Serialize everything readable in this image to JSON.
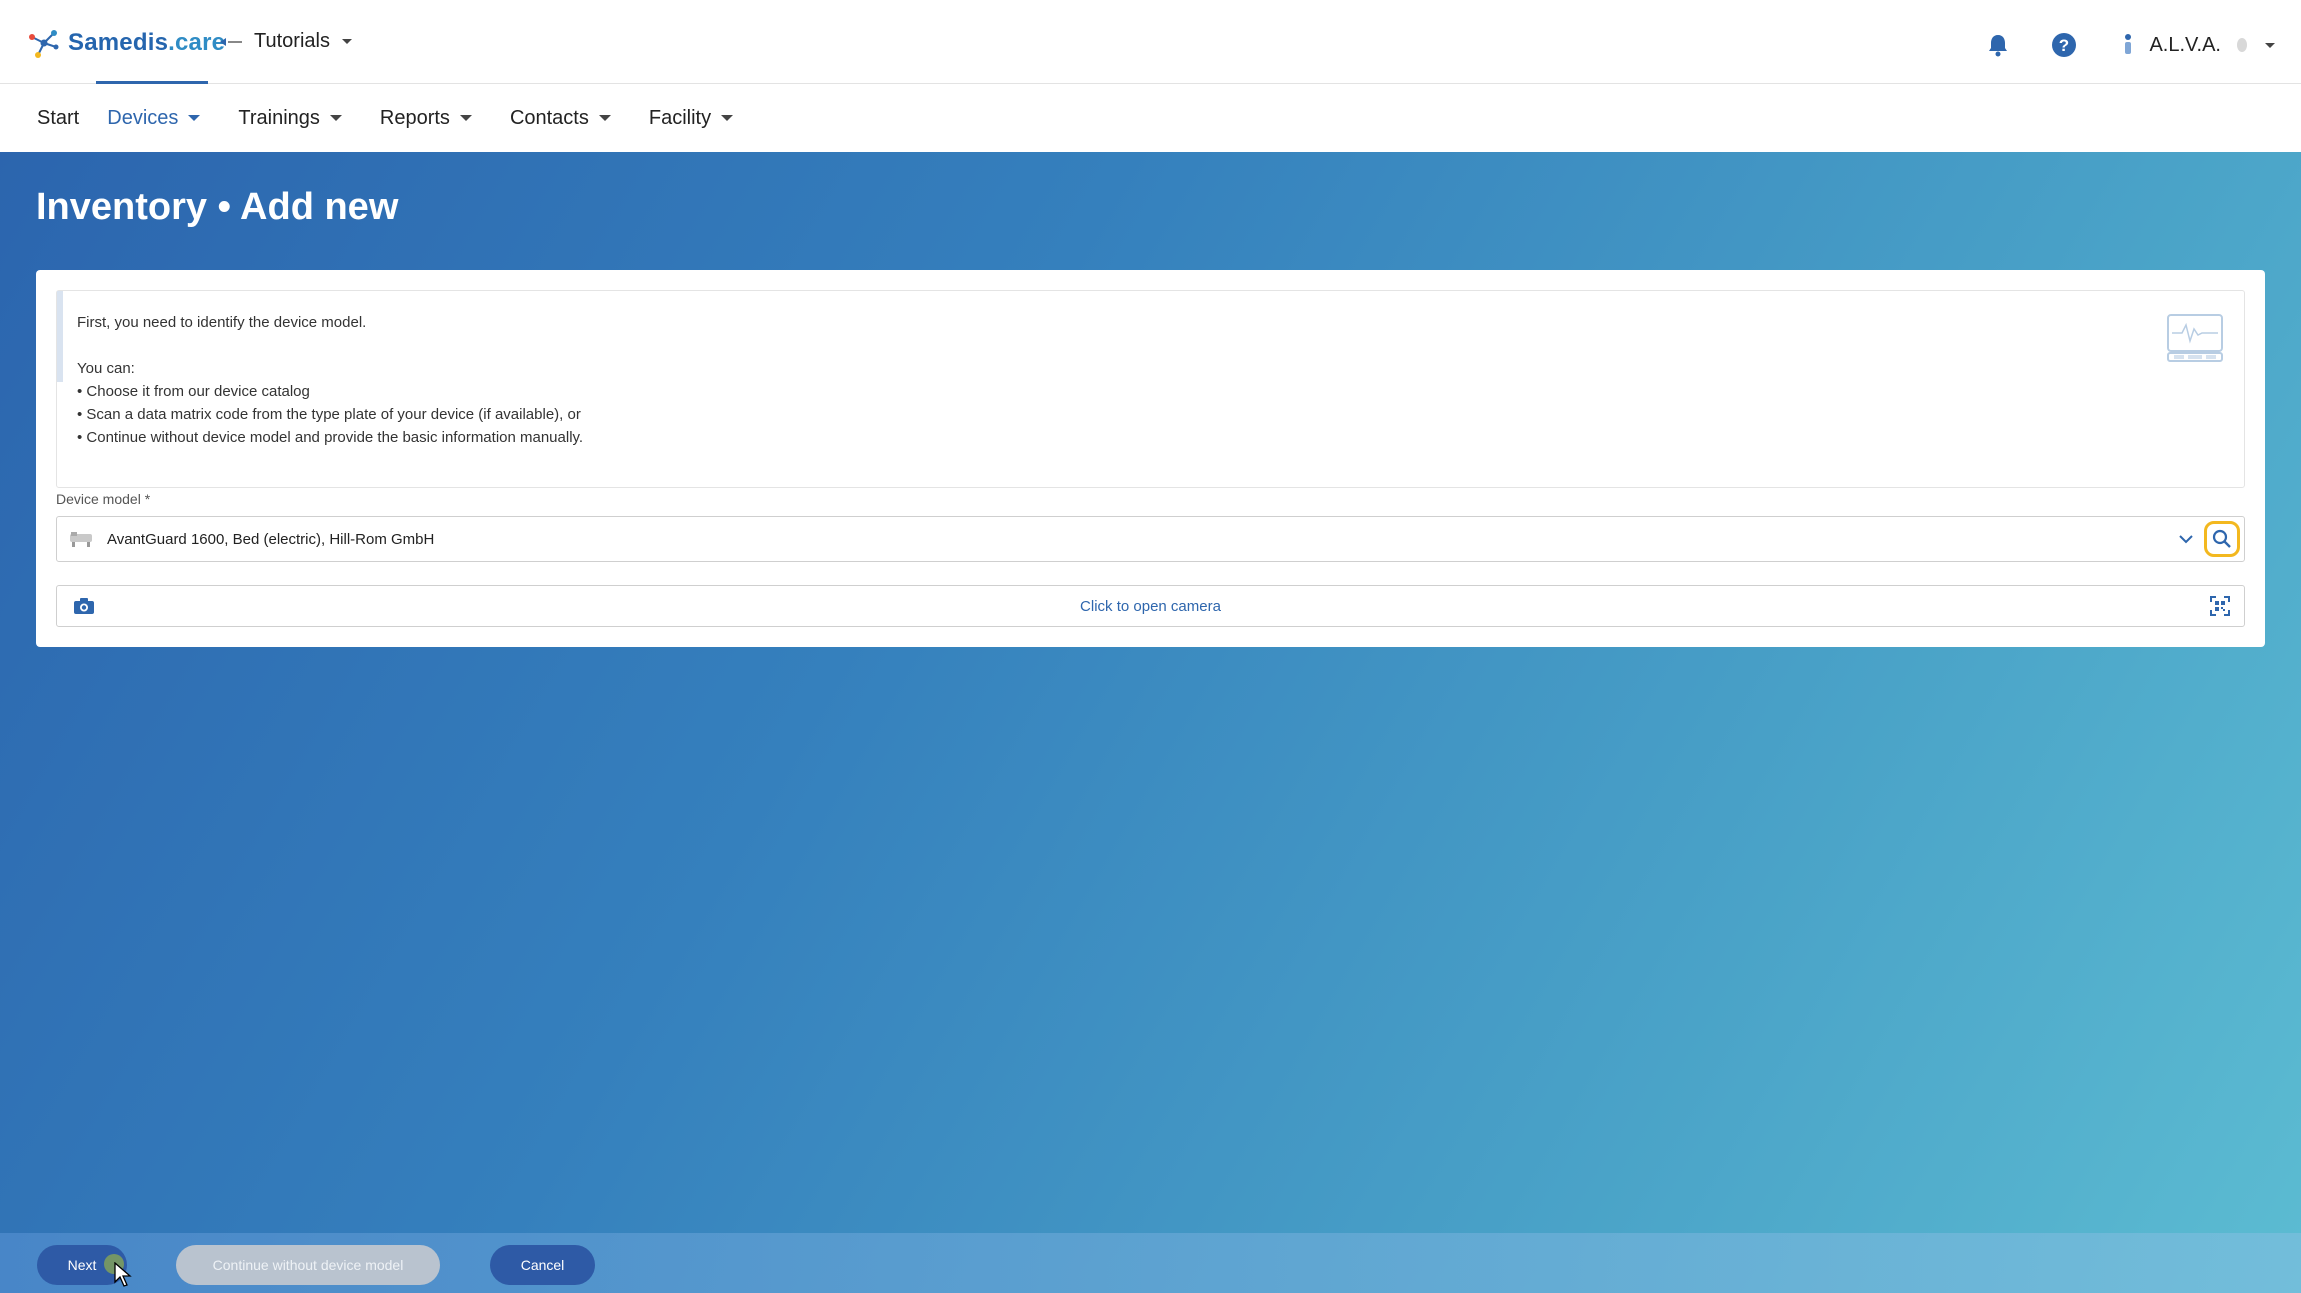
{
  "brand": {
    "name_main": "Samedis",
    "name_suffix": ".care"
  },
  "tenant": {
    "name": "Tutorials"
  },
  "user": {
    "name": "A.L.V.A."
  },
  "nav": {
    "items": [
      {
        "label": "Start",
        "active": false
      },
      {
        "label": "Devices",
        "active": true
      },
      {
        "label": "Trainings",
        "active": false
      },
      {
        "label": "Reports",
        "active": false
      },
      {
        "label": "Contacts",
        "active": false
      },
      {
        "label": "Facility",
        "active": false
      }
    ]
  },
  "page": {
    "title": "Inventory • Add new"
  },
  "info": {
    "line1": "First, you need to identify the device model.",
    "line2": "You can:",
    "bullet1": "• Choose it from our device catalog",
    "bullet2": "• Scan a data matrix code from the type plate of your device (if available), or",
    "bullet3": "• Continue without device model and provide the basic information manually."
  },
  "device_model": {
    "label": "Device model *",
    "value": "AvantGuard 1600, Bed (electric), Hill-Rom GmbH"
  },
  "camera": {
    "label": "Click to open camera"
  },
  "footer": {
    "next_label": "Next",
    "continue_label": "Continue without device model",
    "cancel_label": "Cancel"
  },
  "colors": {
    "primary": "#2e66ad",
    "highlight": "#f3b81f",
    "disabled": "#b9c3cf"
  },
  "icons": [
    "bell-icon",
    "help-icon",
    "user-icon",
    "camera-icon",
    "qr-scan-icon",
    "search-icon",
    "chevron-down-icon"
  ]
}
